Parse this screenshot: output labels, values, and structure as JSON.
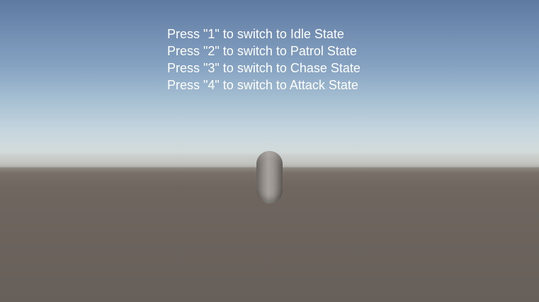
{
  "hud": {
    "instructions": [
      "Press \"1\" to switch to Idle State",
      "Press \"2\" to switch to Patrol State",
      "Press \"3\" to switch to Chase State",
      "Press \"4\" to switch to Attack State"
    ]
  },
  "scene": {
    "sky_top_color": "#5f7aa1",
    "horizon_color": "#d3dbdb",
    "ground_color": "#6a625b",
    "capsule_color": "#a7a29d"
  }
}
